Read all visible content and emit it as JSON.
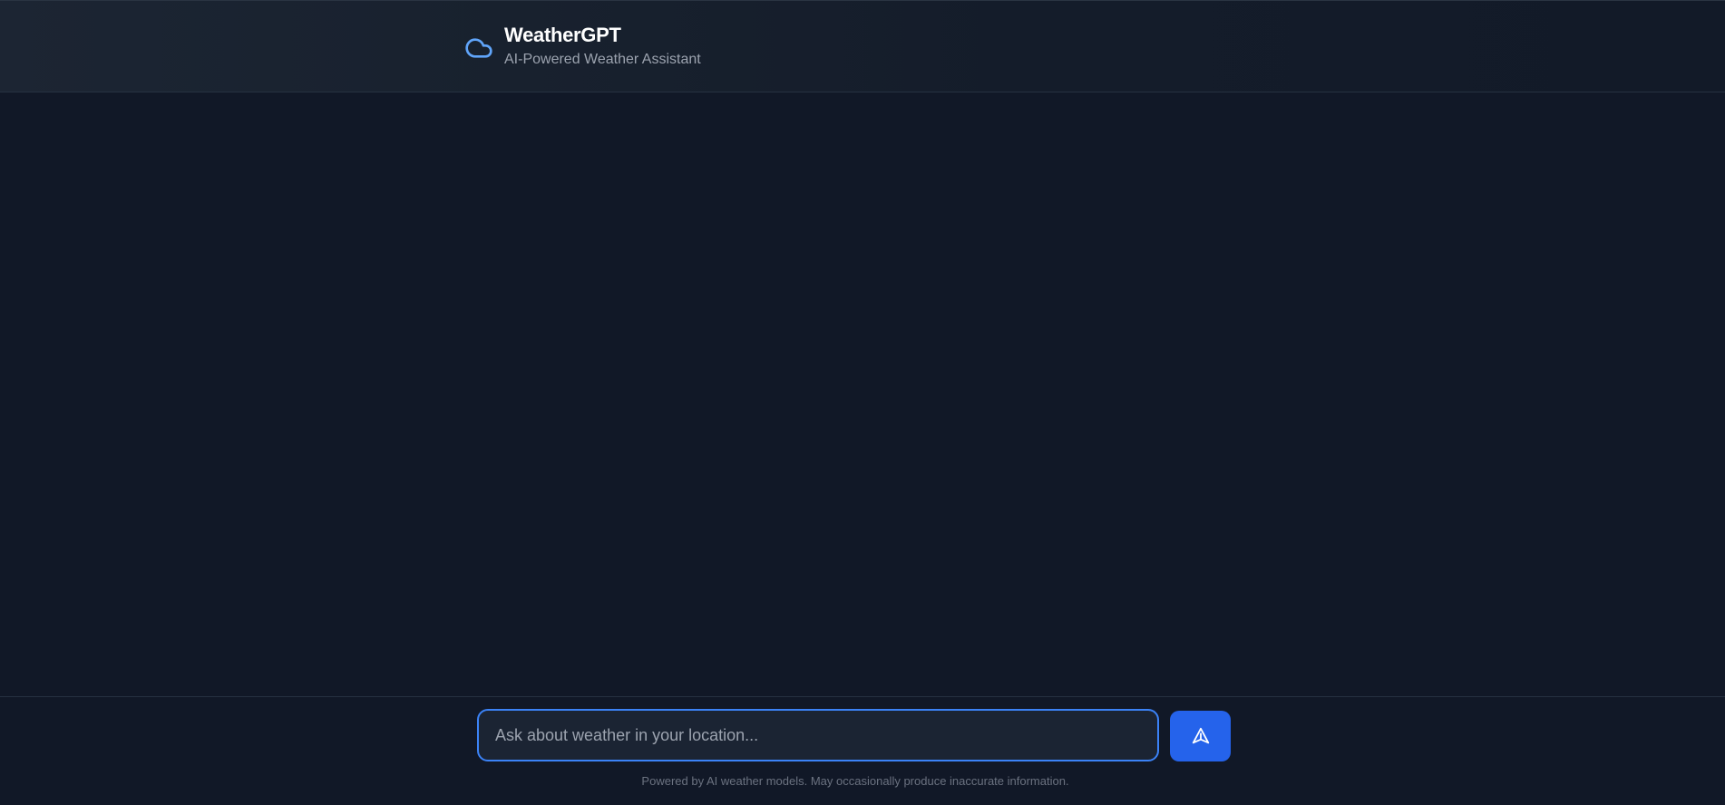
{
  "header": {
    "icon": "cloud-icon",
    "title": "WeatherGPT",
    "subtitle": "AI-Powered Weather Assistant"
  },
  "chat": {
    "messages": []
  },
  "composer": {
    "input_value": "",
    "placeholder": "Ask about weather in your location...",
    "send_icon": "send-icon"
  },
  "footer": {
    "disclaimer": "Powered by AI weather models. May occasionally produce inaccurate information."
  },
  "colors": {
    "background": "#111827",
    "accent": "#2563eb",
    "input_border": "#3b82f6",
    "icon": "#60a5fa"
  }
}
